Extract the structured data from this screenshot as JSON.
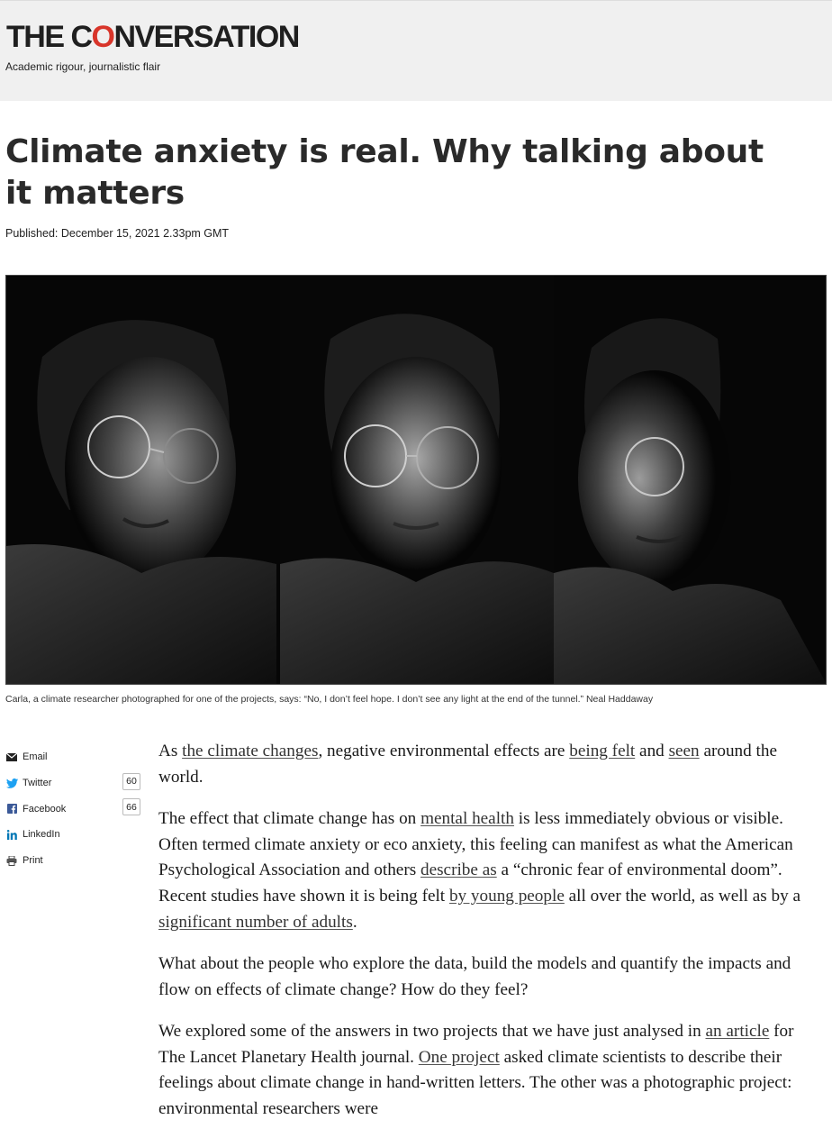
{
  "masthead": {
    "logo_before": "THE C",
    "logo_bubble": "O",
    "logo_after": "NVERSATION",
    "tagline": "Academic rigour, journalistic flair",
    "accent_color": "#d8352a"
  },
  "article": {
    "title": "Climate anxiety is real. Why talking about it matters",
    "published": "Published: December 15, 2021 2.33pm GMT",
    "caption": "Carla, a climate researcher photographed for one of the projects, says: “No, I don’t feel hope. I don’t see any light at the end of the tunnel.” Neal Haddaway"
  },
  "share": {
    "email": "Email",
    "twitter": "Twitter",
    "twitter_count": "60",
    "facebook": "Facebook",
    "facebook_count": "66",
    "linkedin": "LinkedIn",
    "print": "Print"
  },
  "body": {
    "p1": {
      "t1": "As ",
      "l1": "the climate changes",
      "t2": ", negative environmental effects are ",
      "l2": "being felt",
      "t3": " and ",
      "l3": "seen",
      "t4": " around the world."
    },
    "p2": {
      "t1": "The effect that climate change has on ",
      "l1": "mental health",
      "t2": " is less immediately obvious or visible. Often termed climate anxiety or eco anxiety, this feeling can manifest as what the American Psychological Association and others ",
      "l2": "describe as",
      "t3": " a “chronic fear of environmental doom”. Recent studies have shown it is being felt ",
      "l3": "by young people",
      "t4": " all over the world, as well as by a ",
      "l4": "significant number of adults",
      "t5": "."
    },
    "p3": "What about the people who explore the data, build the models and quantify the impacts and flow on effects of climate change? How do they feel?",
    "p4": {
      "t1": "We explored some of the answers in two projects that we have just analysed in ",
      "l1": "an article",
      "t2": " for The Lancet Planetary Health journal. ",
      "l2": "One project",
      "t3": " asked climate scientists to describe their feelings about climate change in hand-written letters. The other was a photographic project: environmental researchers were"
    }
  }
}
